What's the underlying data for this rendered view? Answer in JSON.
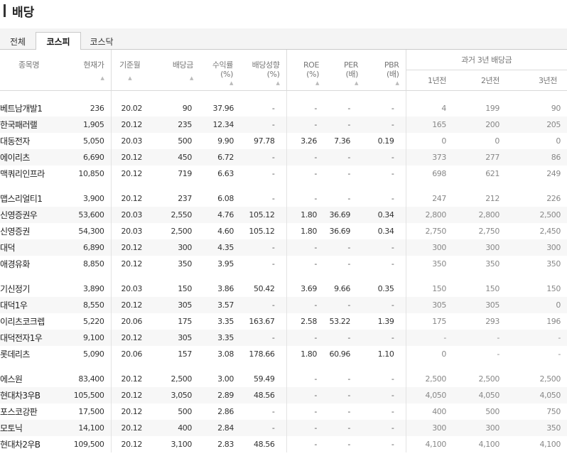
{
  "page": {
    "title": "배당"
  },
  "tabs": {
    "all": "전체",
    "kospi": "코스피",
    "kosdaq": "코스닥",
    "active": "kospi"
  },
  "columns": {
    "name": "종목명",
    "price": "현재가",
    "base_month": "기준월",
    "dividend": "배당금",
    "yield_label": "수익률",
    "yield_unit": "(%)",
    "payout_label": "배당성향",
    "payout_unit": "(%)",
    "roe_label": "ROE",
    "roe_unit": "(%)",
    "per_label": "PER",
    "per_unit": "(배)",
    "pbr_label": "PBR",
    "pbr_unit": "(배)",
    "past_group": "과거 3년 배당금",
    "past_1y": "1년전",
    "past_2y": "2년전",
    "past_3y": "3년전",
    "sort_indicator": "▲"
  },
  "groups": [
    [
      [
        "베트남개발1",
        "236",
        "20.02",
        "90",
        "37.96",
        "-",
        "-",
        "-",
        "-",
        "4",
        "199",
        "90"
      ],
      [
        "한국패러랠",
        "1,905",
        "20.12",
        "235",
        "12.34",
        "-",
        "-",
        "-",
        "-",
        "165",
        "200",
        "205"
      ],
      [
        "대동전자",
        "5,050",
        "20.03",
        "500",
        "9.90",
        "97.78",
        "3.26",
        "7.36",
        "0.19",
        "0",
        "0",
        "0"
      ],
      [
        "에이리츠",
        "6,690",
        "20.12",
        "450",
        "6.72",
        "-",
        "-",
        "-",
        "-",
        "373",
        "277",
        "86"
      ],
      [
        "맥쿼리인프라",
        "10,850",
        "20.12",
        "719",
        "6.63",
        "-",
        "-",
        "-",
        "-",
        "698",
        "621",
        "249"
      ]
    ],
    [
      [
        "맵스리얼티1",
        "3,900",
        "20.12",
        "237",
        "6.08",
        "-",
        "-",
        "-",
        "-",
        "247",
        "212",
        "226"
      ],
      [
        "신영증권우",
        "53,600",
        "20.03",
        "2,550",
        "4.76",
        "105.12",
        "1.80",
        "36.69",
        "0.34",
        "2,800",
        "2,800",
        "2,500"
      ],
      [
        "신영증권",
        "54,300",
        "20.03",
        "2,500",
        "4.60",
        "105.12",
        "1.80",
        "36.69",
        "0.34",
        "2,750",
        "2,750",
        "2,450"
      ],
      [
        "대덕",
        "6,890",
        "20.12",
        "300",
        "4.35",
        "-",
        "-",
        "-",
        "-",
        "300",
        "300",
        "300"
      ],
      [
        "애경유화",
        "8,850",
        "20.12",
        "350",
        "3.95",
        "-",
        "-",
        "-",
        "-",
        "350",
        "350",
        "350"
      ]
    ],
    [
      [
        "기신정기",
        "3,890",
        "20.03",
        "150",
        "3.86",
        "50.42",
        "3.69",
        "9.66",
        "0.35",
        "150",
        "150",
        "150"
      ],
      [
        "대덕1우",
        "8,550",
        "20.12",
        "305",
        "3.57",
        "-",
        "-",
        "-",
        "-",
        "305",
        "305",
        "0"
      ],
      [
        "이리츠코크렙",
        "5,220",
        "20.06",
        "175",
        "3.35",
        "163.67",
        "2.58",
        "53.22",
        "1.39",
        "175",
        "293",
        "196"
      ],
      [
        "대덕전자1우",
        "9,100",
        "20.12",
        "305",
        "3.35",
        "-",
        "-",
        "-",
        "-",
        "-",
        "-",
        "-"
      ],
      [
        "롯데리츠",
        "5,090",
        "20.06",
        "157",
        "3.08",
        "178.66",
        "1.80",
        "60.96",
        "1.10",
        "0",
        "-",
        "-"
      ]
    ],
    [
      [
        "에스원",
        "83,400",
        "20.12",
        "2,500",
        "3.00",
        "59.49",
        "-",
        "-",
        "-",
        "2,500",
        "2,500",
        "2,500"
      ],
      [
        "현대차3우B",
        "105,500",
        "20.12",
        "3,050",
        "2.89",
        "48.56",
        "-",
        "-",
        "-",
        "4,050",
        "4,050",
        "4,050"
      ],
      [
        "포스코강판",
        "17,500",
        "20.12",
        "500",
        "2.86",
        "-",
        "-",
        "-",
        "-",
        "400",
        "500",
        "750"
      ],
      [
        "모토닉",
        "14,100",
        "20.12",
        "400",
        "2.84",
        "-",
        "-",
        "-",
        "-",
        "300",
        "300",
        "350"
      ],
      [
        "현대차2우B",
        "109,500",
        "20.12",
        "3,100",
        "2.83",
        "48.56",
        "-",
        "-",
        "-",
        "4,100",
        "4,100",
        "4,100"
      ]
    ]
  ]
}
